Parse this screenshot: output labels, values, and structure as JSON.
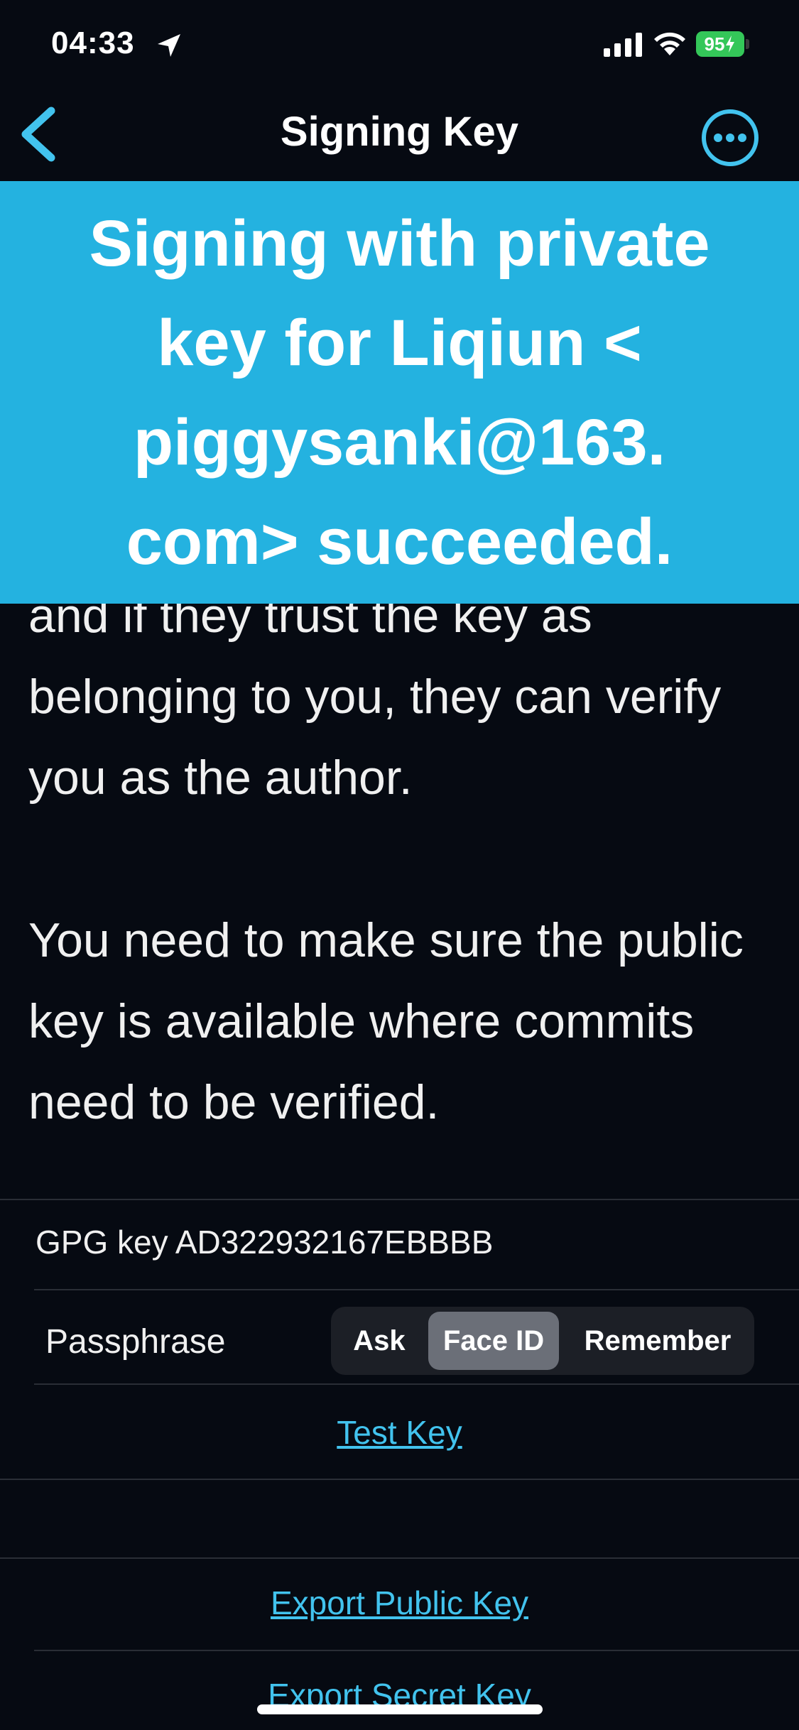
{
  "status_bar": {
    "time": "04:33",
    "battery": "95"
  },
  "nav": {
    "title": "Signing Key",
    "back_icon": "chevron-left-icon",
    "more_icon": "ellipsis-circle-icon"
  },
  "toast": {
    "message": "Signing with private key for Liqiun < piggysanki@163. com> succeeded."
  },
  "description": {
    "paragraph_1": "and if they trust the key as belonging to you, they can verify you as the author.",
    "paragraph_2": "You need to make sure the public key is available where commits need to be verified."
  },
  "key": {
    "label": "GPG key AD322932167EBBBB"
  },
  "passphrase": {
    "label": "Passphrase",
    "options": [
      "Ask",
      "Face ID",
      "Remember"
    ],
    "selected": "Face ID"
  },
  "actions": {
    "test_key": "Test Key",
    "export_public": "Export Public Key",
    "export_secret": "Export Secret Key"
  },
  "colors": {
    "accent": "#42c3ee",
    "toast_bg": "#24b2e0",
    "background": "#060a12"
  }
}
